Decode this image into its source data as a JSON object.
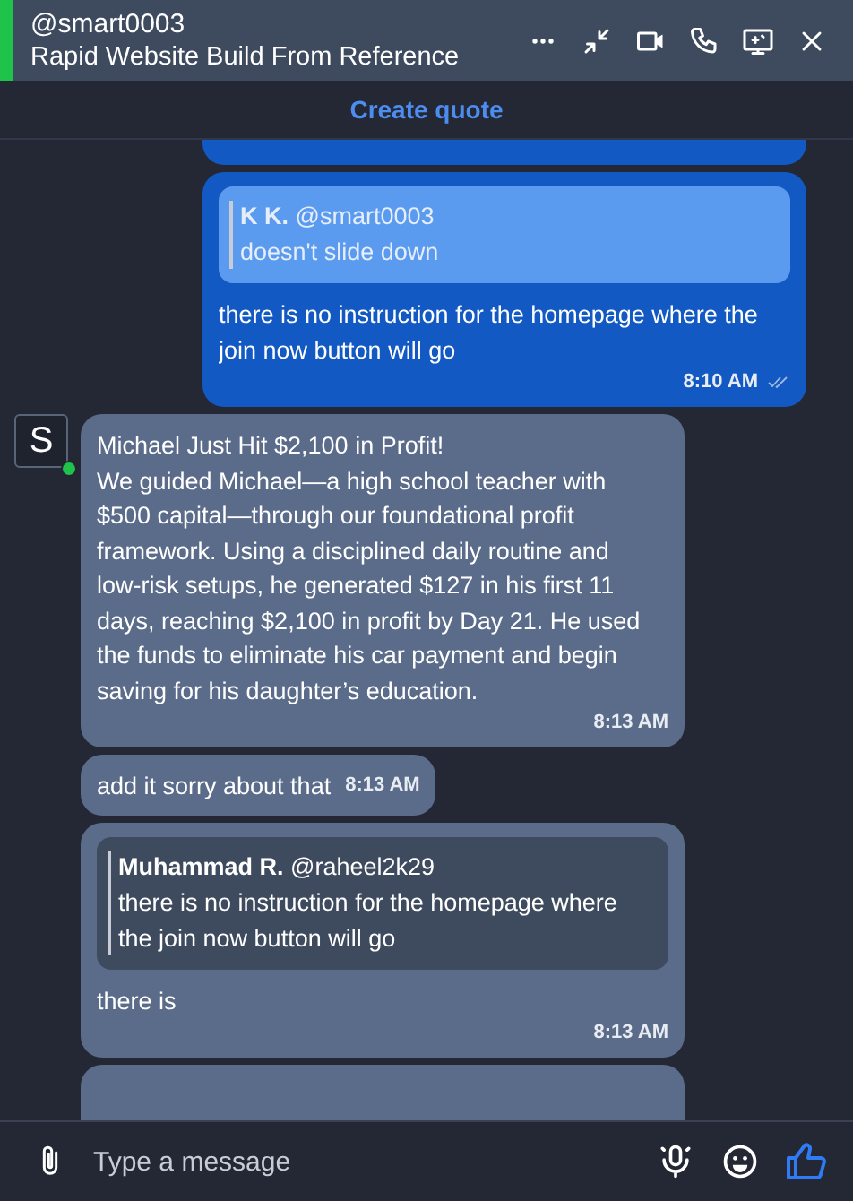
{
  "header": {
    "handle": "@smart0003",
    "title": "Rapid Website Build From Reference",
    "online": true
  },
  "action_bar": {
    "label": "Create quote"
  },
  "messages": [
    {
      "kind": "sentstub"
    },
    {
      "kind": "sent",
      "quote": {
        "author": "K K.",
        "handle": "@smart0003",
        "text": "doesn't slide down"
      },
      "text": "there is no instruction for the homepage where the join now button will go",
      "time": "8:10 AM",
      "read": true
    },
    {
      "kind": "received",
      "avatar": {
        "letter": "S",
        "online": true
      },
      "text": "Michael Just Hit $2,100 in Profit!\nWe guided Michael—a high school teacher with $500 capital—through our foundational profit framework. Using a disciplined daily routine and low-risk setups, he generated $127 in his first 11 days, reaching $2,100 in profit by Day 21. He used the funds to eliminate his car payment and begin saving for his daughter’s education.",
      "time": "8:13 AM"
    },
    {
      "kind": "brief",
      "text": "add it sorry about that",
      "time": "8:13 AM"
    },
    {
      "kind": "received",
      "quote": {
        "author": "Muhammad R.",
        "handle": "@raheel2k29",
        "text": "there is no instruction for the homepage where the join now button will go"
      },
      "text": "there is",
      "time": "8:13 AM"
    },
    {
      "kind": "receivedstub"
    }
  ],
  "composer": {
    "placeholder": "Type a message"
  }
}
